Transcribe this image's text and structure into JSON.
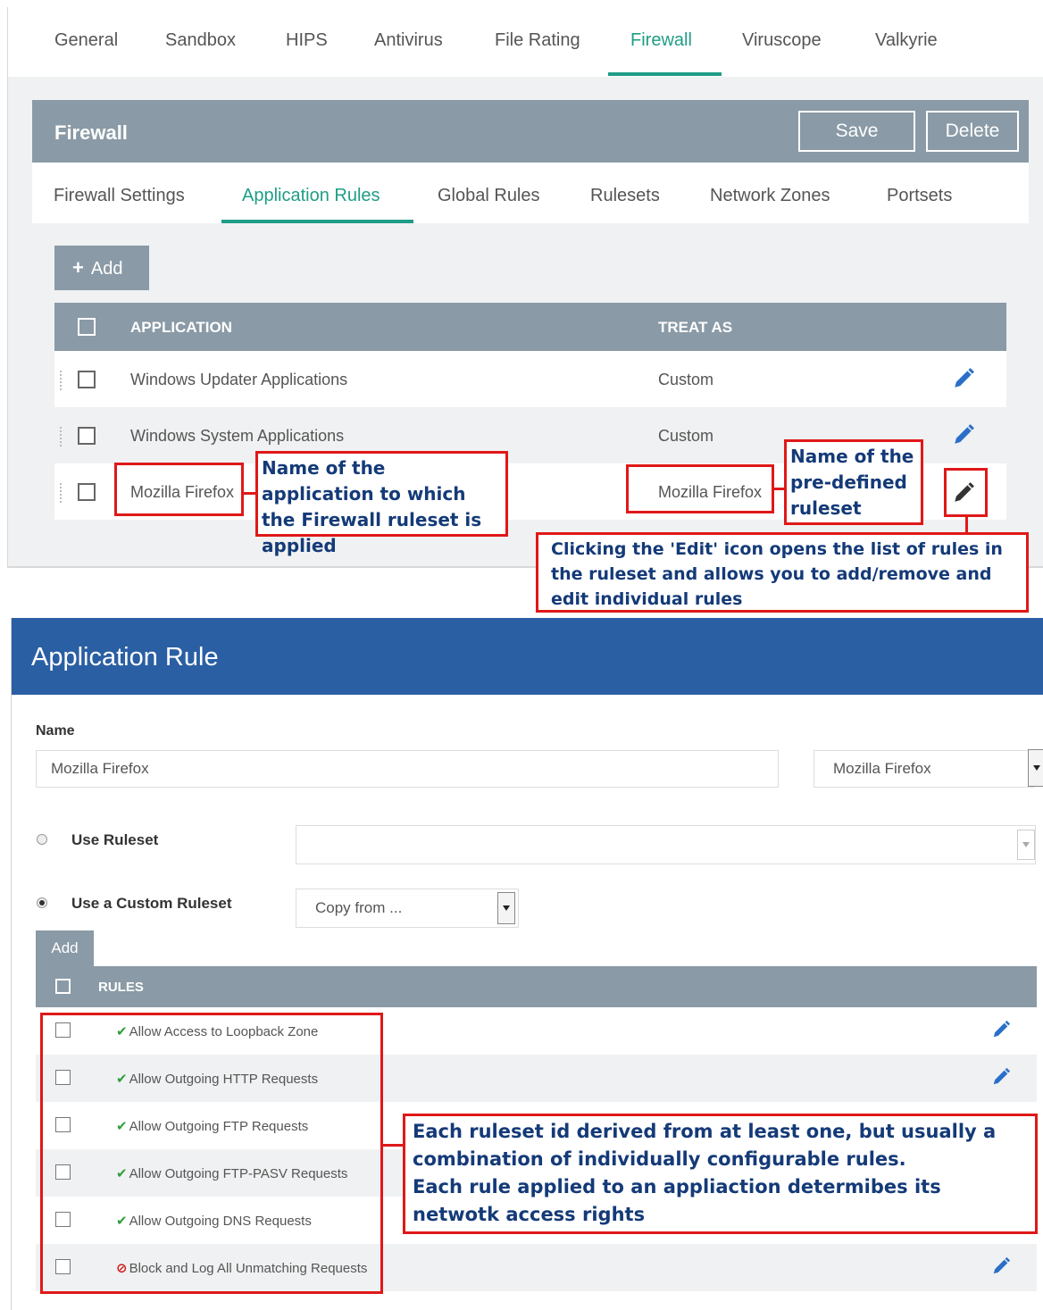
{
  "main_tabs": [
    "General",
    "Sandbox",
    "HIPS",
    "Antivirus",
    "File Rating",
    "Firewall",
    "Viruscope",
    "Valkyrie"
  ],
  "main_tab_active": "Firewall",
  "firewall_section": {
    "title": "Firewall",
    "save_label": "Save",
    "delete_label": "Delete",
    "sub_tabs": [
      "Firewall Settings",
      "Application Rules",
      "Global Rules",
      "Rulesets",
      "Network Zones",
      "Portsets"
    ],
    "sub_tab_active": "Application Rules",
    "add_label": "Add",
    "table_headers": {
      "application": "APPLICATION",
      "treat_as": "TREAT AS"
    },
    "rows": [
      {
        "application": "Windows Updater Applications",
        "treat_as": "Custom"
      },
      {
        "application": "Windows System Applications",
        "treat_as": "Custom"
      },
      {
        "application": "Mozilla Firefox",
        "treat_as": "Mozilla Firefox"
      }
    ]
  },
  "application_rule_dialog": {
    "title": "Application Rule",
    "name_label": "Name",
    "name_value": "Mozilla Firefox",
    "ruleset_select_value": "Mozilla Firefox",
    "use_ruleset_label": "Use Ruleset",
    "use_custom_ruleset_label": "Use a Custom Ruleset",
    "copy_from_value": "Copy from ...",
    "add_label": "Add",
    "rules_header": "RULES",
    "rules": [
      {
        "label": "Allow Access to Loopback Zone",
        "status": "allow",
        "icon": "check-icon"
      },
      {
        "label": "Allow Outgoing HTTP Requests",
        "status": "allow",
        "icon": "check-icon"
      },
      {
        "label": "Allow Outgoing FTP Requests",
        "status": "allow",
        "icon": "check-icon"
      },
      {
        "label": "Allow Outgoing FTP-PASV Requests",
        "status": "allow",
        "icon": "check-icon"
      },
      {
        "label": "Allow Outgoing DNS Requests",
        "status": "allow",
        "icon": "check-icon"
      },
      {
        "label": "Block and Log All Unmatching Requests",
        "status": "block",
        "icon": "block-icon"
      }
    ]
  },
  "annotations": {
    "app_name": "Name of the application to which the Firewall ruleset is applied",
    "ruleset_name": "Name of the pre-defined ruleset",
    "edit_icon": "Clicking the 'Edit' icon opens the list of rules in the ruleset and allows you to add/remove and edit individual rules",
    "rules_note_line1": "Each ruleset id derived from at least one, but usually a combination of individually configurable rules.",
    "rules_note_line2": "Each rule applied to an appliaction determibes its netwotk access rights"
  },
  "colors": {
    "accent_green": "#1f9d86",
    "header_gray": "#8a9aa6",
    "dialog_blue": "#2b5fa3",
    "annotation_red": "#e01818",
    "annotation_text": "#143a78",
    "edit_blue": "#2a6fc9"
  }
}
